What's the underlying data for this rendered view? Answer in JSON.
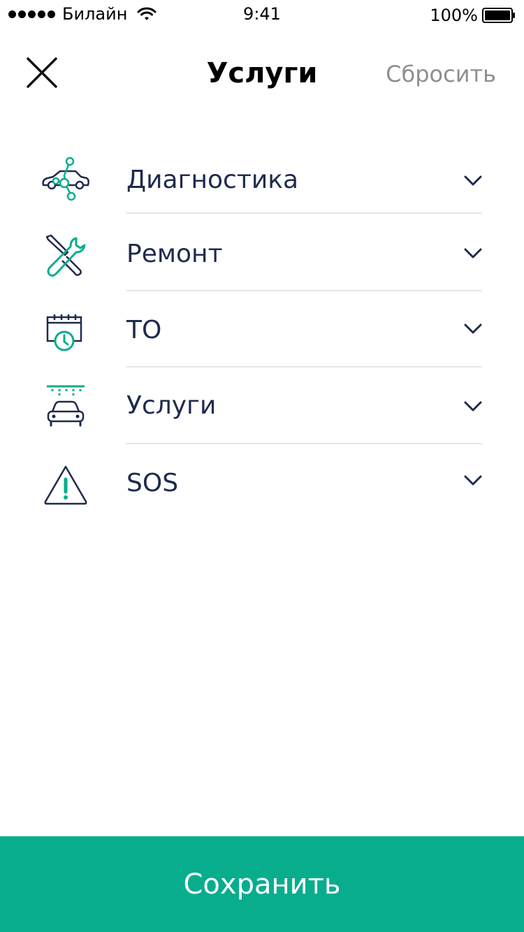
{
  "status_bar": {
    "carrier": "Билайн",
    "time": "9:41",
    "battery": "100%"
  },
  "nav": {
    "title": "Услуги",
    "reset_label": "Сбросить",
    "close_icon": "close-icon"
  },
  "services": [
    {
      "label": "Диагностика",
      "icon": "car-diagnostics-icon"
    },
    {
      "label": "Ремонт",
      "icon": "wrench-screwdriver-icon"
    },
    {
      "label": "ТО",
      "icon": "calendar-clock-icon"
    },
    {
      "label": "Услуги",
      "icon": "car-wash-icon"
    },
    {
      "label": "SOS",
      "icon": "warning-triangle-icon"
    }
  ],
  "save_label": "Сохранить",
  "colors": {
    "accent": "#08ad8e",
    "icon_dark": "#1f2a4d",
    "text": "#1f2a4d",
    "muted": "#8e8e93",
    "divider": "#e6e6ea"
  }
}
